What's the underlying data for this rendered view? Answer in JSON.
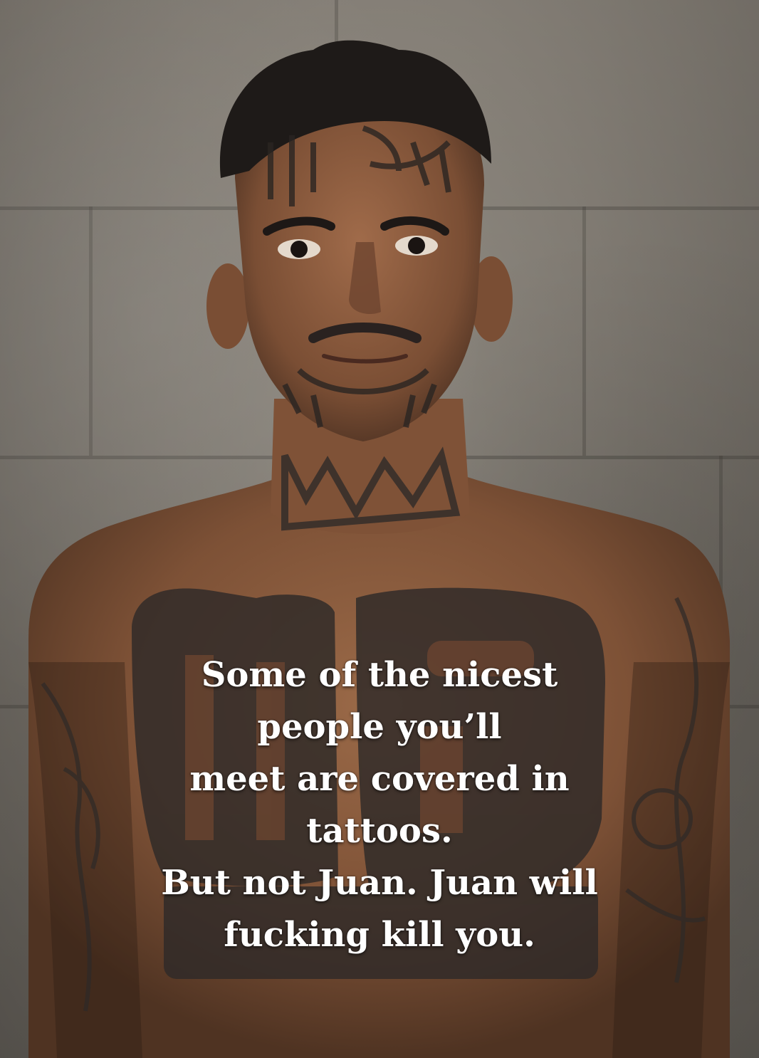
{
  "image": {
    "subject": "tattooed-man-portrait",
    "background_color": "#8f897f",
    "skin_color": "#8a5a3c",
    "tattoo_ink_color": "#2e2a28"
  },
  "caption": {
    "lines": [
      "Some of the nicest",
      "people you’ll",
      "meet are covered in",
      "tattoos.",
      "But not Juan. Juan will",
      "fucking kill you."
    ],
    "color": "#ffffff"
  }
}
